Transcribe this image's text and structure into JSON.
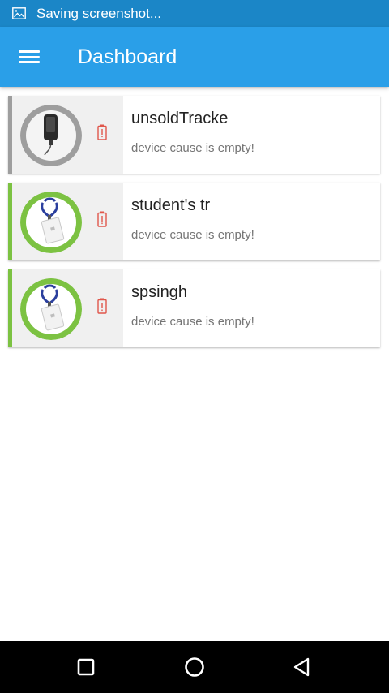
{
  "status_bar": {
    "text": "Saving screenshot...",
    "icon": "image-icon"
  },
  "app_bar": {
    "title": "Dashboard",
    "menu_icon": "hamburger-menu-icon"
  },
  "devices": [
    {
      "name": "unsoldTracke",
      "cause": "device cause is empty!",
      "status_color": "#9e9e9e",
      "avatar_type": "tracker",
      "battery_icon": "battery-alert-icon"
    },
    {
      "name": "student's tr",
      "cause": "device cause is empty!",
      "status_color": "#7cc242",
      "avatar_type": "id-card",
      "battery_icon": "battery-alert-icon"
    },
    {
      "name": "spsingh",
      "cause": "device cause is empty!",
      "status_color": "#7cc242",
      "avatar_type": "id-card",
      "battery_icon": "battery-alert-icon"
    }
  ],
  "nav_bar": {
    "recents_icon": "square-recents-icon",
    "home_icon": "circle-home-icon",
    "back_icon": "triangle-back-icon"
  },
  "colors": {
    "status_bar": "#1b86c7",
    "app_bar": "#2a9fe8",
    "battery_alert": "#e0564b",
    "active_stripe": "#7cc242",
    "inactive_stripe": "#9e9e9e"
  }
}
